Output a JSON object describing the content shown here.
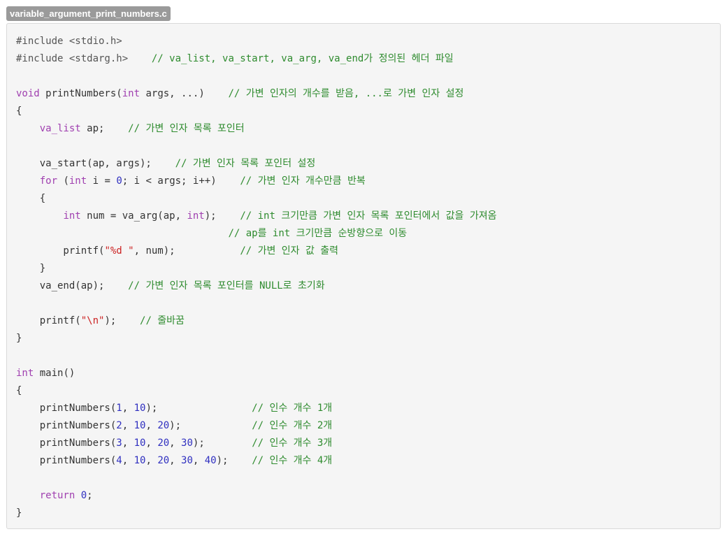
{
  "file_tab": {
    "name": "variable_argument_print_numbers.c"
  },
  "colors": {
    "keyword": "#a040b0",
    "number": "#3030c0",
    "string": "#cc2222",
    "comment": "#2e8b2e",
    "text": "#333333",
    "background": "#f5f5f5"
  },
  "code": {
    "lines": [
      [
        {
          "t": "pp",
          "v": "#include <stdio.h>"
        }
      ],
      [
        {
          "t": "pp",
          "v": "#include <stdarg.h>"
        },
        {
          "t": "p",
          "v": "    "
        },
        {
          "t": "cm",
          "v": "// va_list, va_start, va_arg, va_end가 정의된 헤더 파일"
        }
      ],
      [],
      [
        {
          "t": "kw",
          "v": "void"
        },
        {
          "t": "p",
          "v": " printNumbers("
        },
        {
          "t": "kw",
          "v": "int"
        },
        {
          "t": "p",
          "v": " args, ...)    "
        },
        {
          "t": "cm",
          "v": "// 가변 인자의 개수를 받음, ...로 가변 인자 설정"
        }
      ],
      [
        {
          "t": "p",
          "v": "{"
        }
      ],
      [
        {
          "t": "p",
          "v": "    "
        },
        {
          "t": "kw",
          "v": "va_list"
        },
        {
          "t": "p",
          "v": " ap;    "
        },
        {
          "t": "cm",
          "v": "// 가변 인자 목록 포인터"
        }
      ],
      [],
      [
        {
          "t": "p",
          "v": "    va_start(ap, args);    "
        },
        {
          "t": "cm",
          "v": "// 가변 인자 목록 포인터 설정"
        }
      ],
      [
        {
          "t": "p",
          "v": "    "
        },
        {
          "t": "kw",
          "v": "for"
        },
        {
          "t": "p",
          "v": " ("
        },
        {
          "t": "kw",
          "v": "int"
        },
        {
          "t": "p",
          "v": " i = "
        },
        {
          "t": "num",
          "v": "0"
        },
        {
          "t": "p",
          "v": "; i < args; i++)    "
        },
        {
          "t": "cm",
          "v": "// 가변 인자 개수만큼 반복"
        }
      ],
      [
        {
          "t": "p",
          "v": "    {"
        }
      ],
      [
        {
          "t": "p",
          "v": "        "
        },
        {
          "t": "kw",
          "v": "int"
        },
        {
          "t": "p",
          "v": " num = va_arg(ap, "
        },
        {
          "t": "kw",
          "v": "int"
        },
        {
          "t": "p",
          "v": ");    "
        },
        {
          "t": "cm",
          "v": "// int 크기만큼 가변 인자 목록 포인터에서 값을 가져옴"
        }
      ],
      [
        {
          "t": "p",
          "v": "                                    "
        },
        {
          "t": "cm",
          "v": "// ap를 int 크기만큼 순방향으로 이동"
        }
      ],
      [
        {
          "t": "p",
          "v": "        printf("
        },
        {
          "t": "str",
          "v": "\"%d \""
        },
        {
          "t": "p",
          "v": ", num);           "
        },
        {
          "t": "cm",
          "v": "// 가변 인자 값 출력"
        }
      ],
      [
        {
          "t": "p",
          "v": "    }"
        }
      ],
      [
        {
          "t": "p",
          "v": "    va_end(ap);    "
        },
        {
          "t": "cm",
          "v": "// 가변 인자 목록 포인터를 NULL로 초기화"
        }
      ],
      [],
      [
        {
          "t": "p",
          "v": "    printf("
        },
        {
          "t": "str",
          "v": "\"\\n\""
        },
        {
          "t": "p",
          "v": ");    "
        },
        {
          "t": "cm",
          "v": "// 줄바꿈"
        }
      ],
      [
        {
          "t": "p",
          "v": "}"
        }
      ],
      [],
      [
        {
          "t": "kw",
          "v": "int"
        },
        {
          "t": "p",
          "v": " main()"
        }
      ],
      [
        {
          "t": "p",
          "v": "{"
        }
      ],
      [
        {
          "t": "p",
          "v": "    printNumbers("
        },
        {
          "t": "num",
          "v": "1"
        },
        {
          "t": "p",
          "v": ", "
        },
        {
          "t": "num",
          "v": "10"
        },
        {
          "t": "p",
          "v": ");                "
        },
        {
          "t": "cm",
          "v": "// 인수 개수 1개"
        }
      ],
      [
        {
          "t": "p",
          "v": "    printNumbers("
        },
        {
          "t": "num",
          "v": "2"
        },
        {
          "t": "p",
          "v": ", "
        },
        {
          "t": "num",
          "v": "10"
        },
        {
          "t": "p",
          "v": ", "
        },
        {
          "t": "num",
          "v": "20"
        },
        {
          "t": "p",
          "v": ");            "
        },
        {
          "t": "cm",
          "v": "// 인수 개수 2개"
        }
      ],
      [
        {
          "t": "p",
          "v": "    printNumbers("
        },
        {
          "t": "num",
          "v": "3"
        },
        {
          "t": "p",
          "v": ", "
        },
        {
          "t": "num",
          "v": "10"
        },
        {
          "t": "p",
          "v": ", "
        },
        {
          "t": "num",
          "v": "20"
        },
        {
          "t": "p",
          "v": ", "
        },
        {
          "t": "num",
          "v": "30"
        },
        {
          "t": "p",
          "v": ");        "
        },
        {
          "t": "cm",
          "v": "// 인수 개수 3개"
        }
      ],
      [
        {
          "t": "p",
          "v": "    printNumbers("
        },
        {
          "t": "num",
          "v": "4"
        },
        {
          "t": "p",
          "v": ", "
        },
        {
          "t": "num",
          "v": "10"
        },
        {
          "t": "p",
          "v": ", "
        },
        {
          "t": "num",
          "v": "20"
        },
        {
          "t": "p",
          "v": ", "
        },
        {
          "t": "num",
          "v": "30"
        },
        {
          "t": "p",
          "v": ", "
        },
        {
          "t": "num",
          "v": "40"
        },
        {
          "t": "p",
          "v": ");    "
        },
        {
          "t": "cm",
          "v": "// 인수 개수 4개"
        }
      ],
      [],
      [
        {
          "t": "p",
          "v": "    "
        },
        {
          "t": "kw",
          "v": "return"
        },
        {
          "t": "p",
          "v": " "
        },
        {
          "t": "num",
          "v": "0"
        },
        {
          "t": "p",
          "v": ";"
        }
      ],
      [
        {
          "t": "p",
          "v": "}"
        }
      ]
    ]
  }
}
